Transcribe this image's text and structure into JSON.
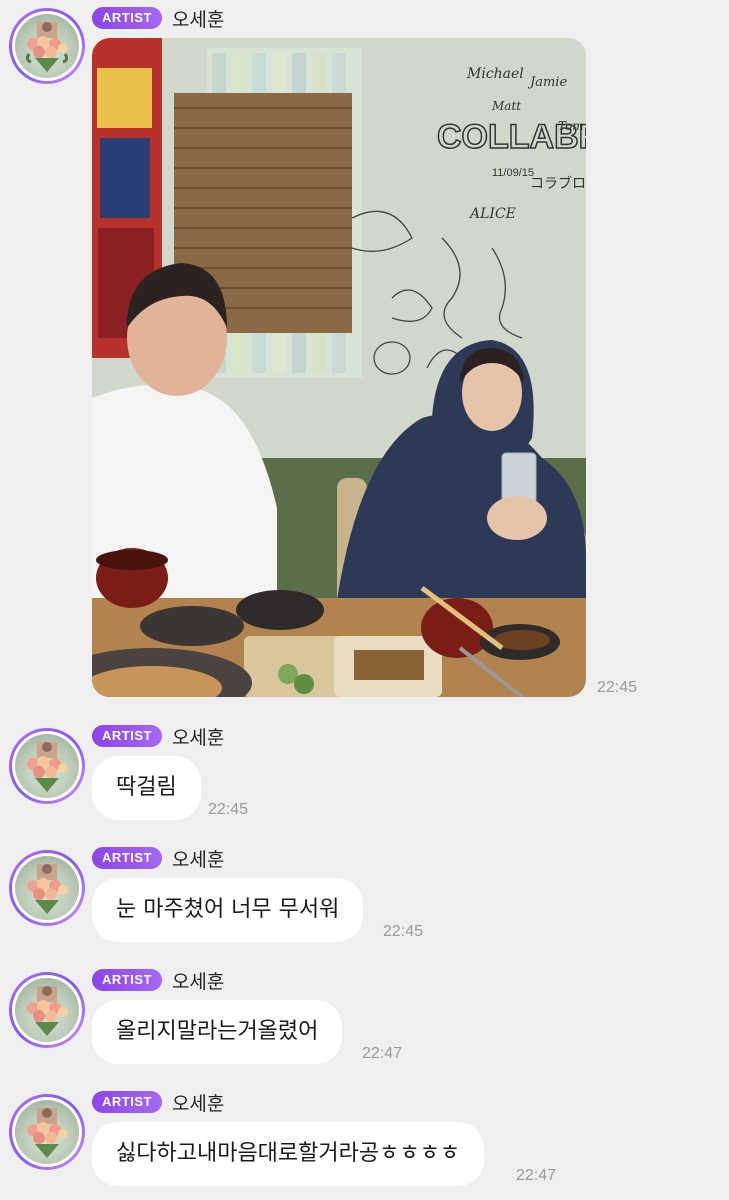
{
  "messages": [
    {
      "badge": "ARTIST",
      "sender": "오세훈",
      "type": "photo",
      "photo_description_icon": "photo-icon",
      "time": "22:45",
      "wall_signatures": {
        "collabro": "COLLABRO",
        "collabro_date": "11/09/15",
        "collabro_jp": "コラブロ",
        "names": [
          "Michael",
          "Jamie",
          "Matt",
          "Tom"
        ],
        "alice": "ALICE"
      }
    },
    {
      "badge": "ARTIST",
      "sender": "오세훈",
      "type": "text",
      "text": "딱걸림",
      "time": "22:45"
    },
    {
      "badge": "ARTIST",
      "sender": "오세훈",
      "type": "text",
      "text": "눈 마주쳤어 너무 무서워",
      "time": "22:45"
    },
    {
      "badge": "ARTIST",
      "sender": "오세훈",
      "type": "text",
      "text": "올리지말라는거올렸어",
      "time": "22:47"
    },
    {
      "badge": "ARTIST",
      "sender": "오세훈",
      "type": "text",
      "text": "싫다하고내마음대로할거라공ㅎㅎㅎㅎ",
      "time": "22:47"
    }
  ],
  "colors": {
    "background": "#efefef",
    "badge": "#8b45e8",
    "bubble": "#ffffff",
    "time": "#9a9a9a"
  }
}
